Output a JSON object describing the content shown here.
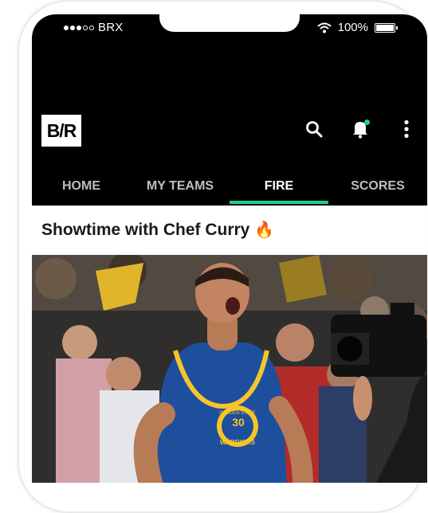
{
  "status_bar": {
    "carrier": "BRX",
    "battery": "100%",
    "battery_level": 1.0
  },
  "header": {
    "logo_text": "B/R",
    "notification_dot_color": "#1fd08a"
  },
  "tabs": [
    {
      "label": "HOME",
      "active": false
    },
    {
      "label": "MY TEAMS",
      "active": false
    },
    {
      "label": "FIRE",
      "active": true
    },
    {
      "label": "SCORES",
      "active": false
    }
  ],
  "feed": {
    "headline": "Showtime with Chef Curry",
    "headline_emoji": "🔥",
    "player": {
      "team": "WARRIORS",
      "jersey_number": "30",
      "jersey_top": "GOLDEN STATE"
    }
  },
  "colors": {
    "accent": "#1fd08a",
    "header_bg": "#000000",
    "jersey": "#1d4f9c",
    "jersey_trim": "#f7c42a"
  }
}
